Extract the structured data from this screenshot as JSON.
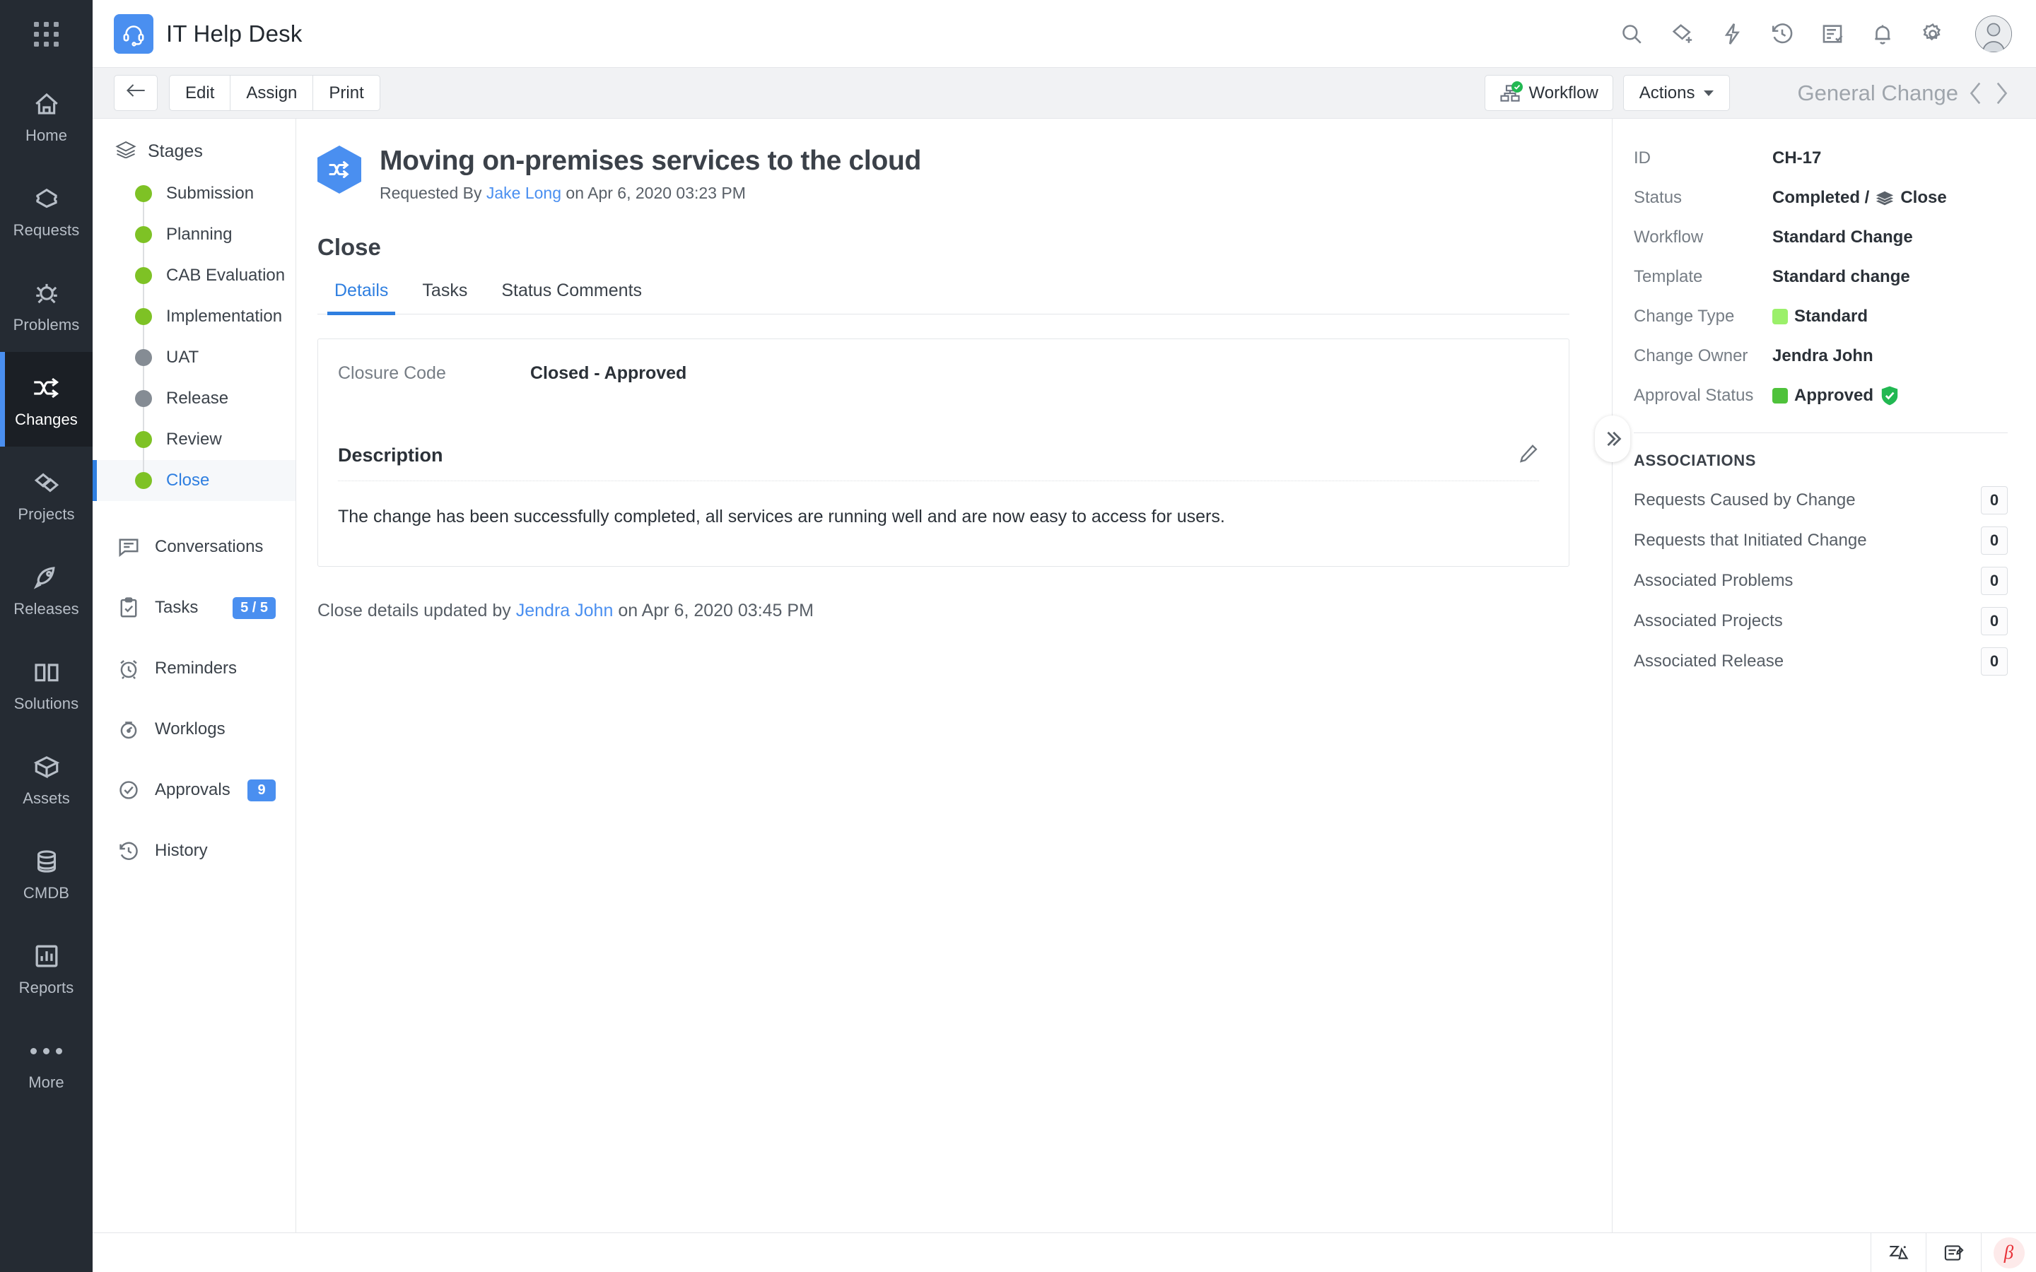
{
  "app": {
    "name": "IT Help Desk",
    "logo_icon": "headset-icon",
    "app_switcher_icon": "grid-apps-icon"
  },
  "rail": {
    "items": [
      {
        "label": "Home",
        "icon": "home-icon",
        "active": false
      },
      {
        "label": "Requests",
        "icon": "ticket-icon",
        "active": false
      },
      {
        "label": "Problems",
        "icon": "bug-icon",
        "active": false
      },
      {
        "label": "Changes",
        "icon": "shuffle-icon",
        "active": true
      },
      {
        "label": "Projects",
        "icon": "projects-icon",
        "active": false
      },
      {
        "label": "Releases",
        "icon": "rocket-icon",
        "active": false
      },
      {
        "label": "Solutions",
        "icon": "book-icon",
        "active": false
      },
      {
        "label": "Assets",
        "icon": "cube-icon",
        "active": false
      },
      {
        "label": "CMDB",
        "icon": "database-icon",
        "active": false
      },
      {
        "label": "Reports",
        "icon": "bar-chart-icon",
        "active": false
      },
      {
        "label": "More",
        "icon": "ellipsis-icon",
        "active": false
      }
    ]
  },
  "header": {
    "icons": [
      "search-icon",
      "add-ticket-icon",
      "lightning-icon",
      "history-icon",
      "task-list-icon",
      "bell-icon",
      "gear-icon"
    ],
    "avatar": "user-avatar"
  },
  "actionbar": {
    "back_icon": "arrow-left-icon",
    "buttons": [
      "Edit",
      "Assign",
      "Print"
    ],
    "workflow_label": "Workflow",
    "workflow_icon": "workflow-icon",
    "actions_label": "Actions",
    "record_type": "General Change",
    "prev_icon": "chevron-left-icon",
    "next_icon": "chevron-right-icon"
  },
  "stages": {
    "heading": "Stages",
    "heading_icon": "layers-icon",
    "items": [
      {
        "label": "Submission",
        "state": "done",
        "color": "#7EC225"
      },
      {
        "label": "Planning",
        "state": "done",
        "color": "#7EC225"
      },
      {
        "label": "CAB Evaluation",
        "state": "done",
        "color": "#7EC225"
      },
      {
        "label": "Implementation",
        "state": "done",
        "color": "#7EC225"
      },
      {
        "label": "UAT",
        "state": "skipped",
        "color": "#858c94"
      },
      {
        "label": "Release",
        "state": "skipped",
        "color": "#858c94"
      },
      {
        "label": "Review",
        "state": "done",
        "color": "#7EC225"
      },
      {
        "label": "Close",
        "state": "current",
        "color": "#7EC225"
      }
    ]
  },
  "side_menu": {
    "items": [
      {
        "label": "Conversations",
        "icon": "chat-icon",
        "badge": null
      },
      {
        "label": "Tasks",
        "icon": "clipboard-check-icon",
        "badge": "5 / 5"
      },
      {
        "label": "Reminders",
        "icon": "alarm-icon",
        "badge": null
      },
      {
        "label": "Worklogs",
        "icon": "stopwatch-icon",
        "badge": null
      },
      {
        "label": "Approvals",
        "icon": "check-circle-icon",
        "badge": "9"
      },
      {
        "label": "History",
        "icon": "history-icon",
        "badge": null
      }
    ]
  },
  "record": {
    "title": "Moving on-premises services to the cloud",
    "icon": "change-hex-icon",
    "requested_by_prefix": "Requested By",
    "requested_by": "Jake Long",
    "requested_on": "on Apr 6, 2020 03:23 PM",
    "section_title": "Close",
    "tabs": [
      {
        "label": "Details",
        "active": true
      },
      {
        "label": "Tasks",
        "active": false
      },
      {
        "label": "Status Comments",
        "active": false
      }
    ],
    "closure_code_label": "Closure Code",
    "closure_code_value": "Closed - Approved",
    "description_label": "Description",
    "description_edit_icon": "pencil-icon",
    "description_text": "The change has been successfully completed, all services are running well and are now easy to access for users.",
    "footnote": "Close details updated by",
    "footnote_user": "Jendra John",
    "footnote_tail": "on Apr 6, 2020 03:45 PM"
  },
  "properties": [
    {
      "key": "ID",
      "value": "CH-17",
      "swatch": null,
      "extra_icon": null
    },
    {
      "key": "Status",
      "value": "Completed /",
      "value2": "Close",
      "swatch": null,
      "extra_icon": "layers-icon"
    },
    {
      "key": "Workflow",
      "value": "Standard Change",
      "swatch": null,
      "extra_icon": null
    },
    {
      "key": "Template",
      "value": "Standard change",
      "swatch": null,
      "extra_icon": null
    },
    {
      "key": "Change Type",
      "value": "Standard",
      "swatch": "#9BF06A",
      "extra_icon": null
    },
    {
      "key": "Change Owner",
      "value": "Jendra John",
      "swatch": null,
      "extra_icon": null
    },
    {
      "key": "Approval Status",
      "value": "Approved",
      "swatch": "#4FC23B",
      "extra_icon": "shield-check-icon"
    }
  ],
  "associations": {
    "title": "ASSOCIATIONS",
    "rows": [
      {
        "label": "Requests Caused by Change",
        "count": "0"
      },
      {
        "label": "Requests that Initiated Change",
        "count": "0"
      },
      {
        "label": "Associated Problems",
        "count": "0"
      },
      {
        "label": "Associated Projects",
        "count": "0"
      },
      {
        "label": "Associated Release",
        "count": "0"
      }
    ],
    "collapse_icon": "chevron-double-right-icon"
  },
  "bottombar": {
    "items": [
      "zia-icon",
      "notes-edit-icon",
      "beta-badge"
    ],
    "beta_glyph": "β"
  }
}
